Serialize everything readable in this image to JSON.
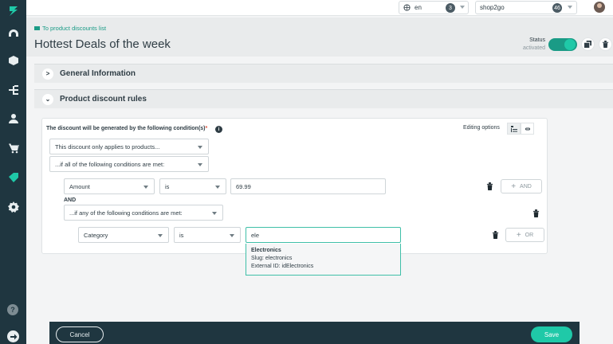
{
  "topbar": {
    "language": "en",
    "language_count": "3",
    "shop": "shop2go",
    "shop_count": "46"
  },
  "header": {
    "back_link": "To product discounts list",
    "title": "Hottest Deals of the week",
    "status_label": "Status",
    "status_value": "activated"
  },
  "sections": {
    "general": "General Information",
    "rules": "Product discount rules"
  },
  "rules": {
    "title": "The discount will be generated by the following condition(s)",
    "required_mark": "*",
    "info": "i",
    "editing_options": "Editing options",
    "applies_to": "This discount only applies to products...",
    "all_condition": "...if all of the following conditions are met:",
    "row1": {
      "field": "Amount",
      "operator": "is",
      "value": "69.99"
    },
    "and_label": "AND",
    "any_condition": "...if any of the following conditions are met:",
    "row2": {
      "field": "Category",
      "operator": "is",
      "value": "ele"
    },
    "and_button": "AND",
    "or_button": "OR"
  },
  "suggestion": {
    "name": "Electronics",
    "slug": "Slug: electronics",
    "external_id": "External ID: idElectronics"
  },
  "footer": {
    "cancel": "Cancel",
    "save": "Save"
  },
  "colors": {
    "sidebar": "#1f3640",
    "accent": "#1fc9a8",
    "link": "#1a9b86"
  }
}
